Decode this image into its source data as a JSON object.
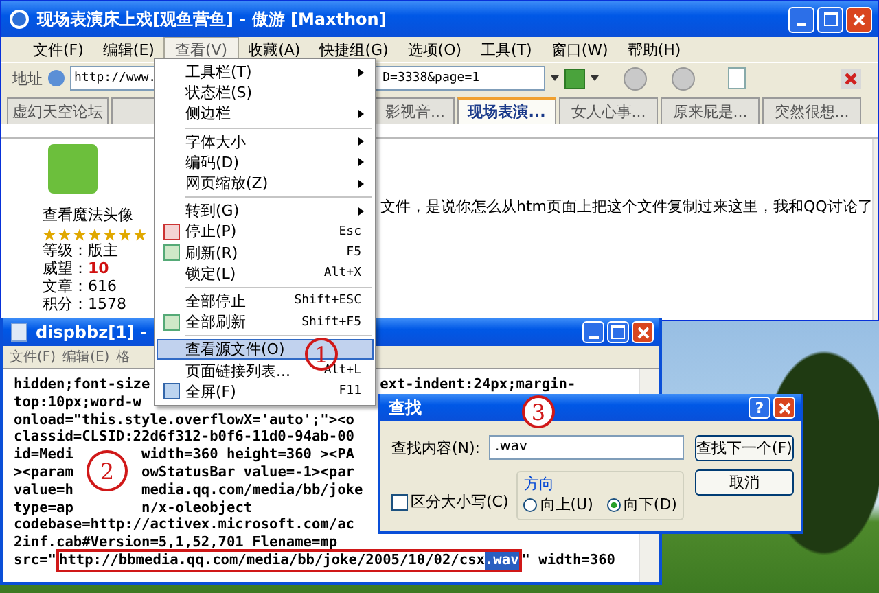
{
  "browser": {
    "title": "现场表演床上戏[观鱼营鱼] - 傲游 [Maxthon]",
    "menu": [
      {
        "label": "文件(F)",
        "selected": false
      },
      {
        "label": "编辑(E)",
        "selected": false
      },
      {
        "label": "查看(V)",
        "selected": true
      },
      {
        "label": "收藏(A)",
        "selected": false
      },
      {
        "label": "快捷组(G)",
        "selected": false
      },
      {
        "label": "选项(O)",
        "selected": false
      },
      {
        "label": "工具(T)",
        "selected": false
      },
      {
        "label": "窗口(W)",
        "selected": false
      },
      {
        "label": "帮助(H)",
        "selected": false
      }
    ],
    "address": {
      "label": "地址",
      "value_start": "http://www.",
      "value_end": "D=3338&page=1"
    },
    "tabs": [
      {
        "label": "虚幻天空论坛",
        "selected": false
      },
      {
        "label": "影视音...",
        "selected": false
      },
      {
        "label": "现场表演...",
        "selected": true
      },
      {
        "label": "女人心事...",
        "selected": false
      },
      {
        "label": "原来屁是...",
        "selected": false
      },
      {
        "label": "突然很想...",
        "selected": false
      }
    ],
    "profile": {
      "avatar_link": "查看魔法头像",
      "stars": 7,
      "stats": [
        {
          "label": "等级：",
          "value": "版主",
          "highlighted": false
        },
        {
          "label": "威望：",
          "value": "10",
          "highlighted": true
        },
        {
          "label": "文章：",
          "value": "616",
          "highlighted": false
        },
        {
          "label": "积分：",
          "value": "1578",
          "highlighted": false
        }
      ]
    },
    "post_text": "文件，是说你怎么从htm页面上把这个文件复制过来这里，我和QQ讨论了"
  },
  "view_menu": [
    {
      "kind": "plain",
      "label": "工具栏(T)",
      "submenu": true,
      "selected": false
    },
    {
      "kind": "plain",
      "label": "状态栏(S)",
      "submenu": false,
      "selected": false
    },
    {
      "kind": "plain",
      "label": "侧边栏",
      "submenu": true,
      "selected": false
    },
    {
      "kind": "separator"
    },
    {
      "kind": "plain",
      "label": "字体大小",
      "submenu": true,
      "selected": false
    },
    {
      "kind": "plain",
      "label": "编码(D)",
      "submenu": true,
      "selected": false
    },
    {
      "kind": "plain",
      "label": "网页缩放(Z)",
      "submenu": true,
      "selected": false
    },
    {
      "kind": "separator"
    },
    {
      "kind": "plain",
      "label": "转到(G)",
      "submenu": true,
      "selected": false
    },
    {
      "kind": "stop",
      "label": "停止(P)",
      "shortcut": "Esc",
      "submenu": false,
      "selected": false
    },
    {
      "kind": "refresh",
      "label": "刷新(R)",
      "shortcut": "F5",
      "submenu": false,
      "selected": false
    },
    {
      "kind": "plain",
      "label": "锁定(L)",
      "shortcut": "Alt+X",
      "submenu": false,
      "selected": false
    },
    {
      "kind": "separator"
    },
    {
      "kind": "plain",
      "label": "全部停止",
      "shortcut": "Shift+ESC",
      "submenu": false,
      "selected": false
    },
    {
      "kind": "refresh",
      "label": "全部刷新",
      "shortcut": "Shift+F5",
      "submenu": false,
      "selected": false
    },
    {
      "kind": "separator"
    },
    {
      "kind": "plain",
      "label": "查看源文件(O)",
      "submenu": false,
      "selected": true
    },
    {
      "kind": "plain",
      "label": "页面链接列表...",
      "shortcut": "Alt+L",
      "submenu": false,
      "selected": false
    },
    {
      "kind": "fullscreen",
      "label": "全屏(F)",
      "shortcut": "F11",
      "submenu": false,
      "selected": false
    }
  ],
  "notepad": {
    "title": "dispbbz[1] -",
    "menu": [
      "文件(F)",
      "编辑(E)",
      "格"
    ],
    "lines": [
      {
        "kind": "hidden",
        "parts": [
          "hidden;font-size",
          "ext-indent:24px;margin-"
        ]
      },
      {
        "kind": "plain",
        "parts": [
          "top:10px;word-w"
        ]
      },
      {
        "kind": "plain",
        "parts": [
          "onload=\"this.style.overflowX='auto';\"><o"
        ]
      },
      {
        "kind": "plain",
        "parts": [
          "classid=CLSID:22d6f312-b0f6-11d0-94ab-00"
        ]
      },
      {
        "kind": "split",
        "parts": [
          "id=Medi",
          "width=360 height=360 ><PA"
        ]
      },
      {
        "kind": "split",
        "parts": [
          "><param",
          "owStatusBar value=-1><par"
        ]
      },
      {
        "kind": "split",
        "parts": [
          "value=h",
          "media.qq.com/media/bb/joke"
        ]
      },
      {
        "kind": "split",
        "parts": [
          "type=ap",
          "n/x-oleobject"
        ]
      },
      {
        "kind": "plain",
        "parts": [
          "codebase=http://activex.microsoft.com/ac"
        ]
      },
      {
        "kind": "plain",
        "parts": [
          "2inf.cab#Version=5,1,52,701 Flename=mp"
        ]
      },
      {
        "kind": "found",
        "parts": [
          "src=\"",
          "http://bbmedia.qq.com/media/bb/joke/2005/10/02/csx",
          ".wav",
          "\" width=360"
        ]
      }
    ]
  },
  "find_dialog": {
    "title": "查找",
    "help": "?",
    "find_label": "查找内容(N):",
    "find_value": ".wav",
    "find_next": "查找下一个(F)",
    "cancel": "取消",
    "direction": {
      "label": "方向",
      "options": [
        {
          "label": "向上(U)",
          "selected": false
        },
        {
          "label": "向下(D)",
          "selected": true
        }
      ]
    },
    "match_case": {
      "label": "区分大小写(C)",
      "checked": false
    }
  },
  "annotations": [
    {
      "label": "1"
    },
    {
      "label": "2"
    },
    {
      "label": "3"
    }
  ]
}
